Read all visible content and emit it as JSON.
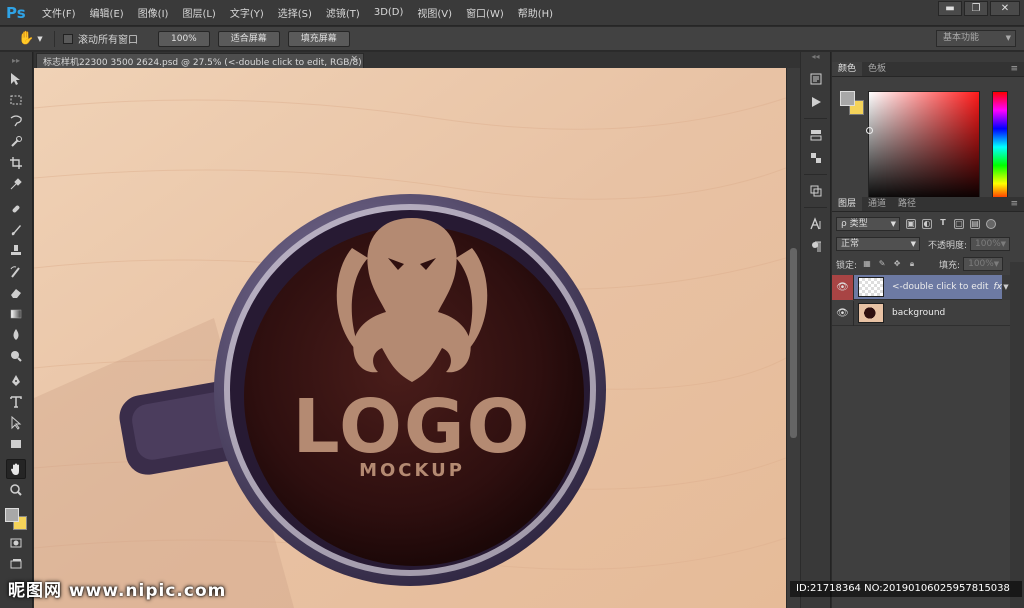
{
  "app": {
    "logo": "Ps",
    "menu": [
      "文件(F)",
      "编辑(E)",
      "图像(I)",
      "图层(L)",
      "文字(Y)",
      "选择(S)",
      "滤镜(T)",
      "3D(D)",
      "视图(V)",
      "窗口(W)",
      "帮助(H)"
    ],
    "window_controls": {
      "minimize": "▬",
      "restore": "❐",
      "close": "✕"
    }
  },
  "options_bar": {
    "scroll_all_label": "滚动所有窗口",
    "scroll_all_checked": false,
    "btn_100": "100%",
    "btn_fit": "适合屏幕",
    "btn_fill": "填充屏幕",
    "workspace": "基本功能"
  },
  "document": {
    "tab_title": "标志样机22300 3500 2624.psd @ 27.5% (<-double click to edit, RGB/8)",
    "tab_close": "×",
    "canvas_logo_text": "LOGO",
    "canvas_sub_text": "MOCKUP"
  },
  "color_panel": {
    "tabs": [
      "颜色",
      "色板"
    ],
    "active_tab": 0,
    "foreground": "#a8a8a8",
    "background": "#f4d35a"
  },
  "layers_panel": {
    "tabs": [
      "图层",
      "通道",
      "路径"
    ],
    "active_tab": 0,
    "filter_label": "ρ 类型",
    "blend_mode": "正常",
    "opacity_label": "不透明度:",
    "opacity_value": "100%",
    "lock_label": "锁定:",
    "fill_label": "填充:",
    "fill_value": "100%",
    "layers": [
      {
        "name": "<-double click to edit",
        "selected": true,
        "fx": "fx"
      },
      {
        "name": "background",
        "selected": false
      }
    ]
  },
  "watermark": {
    "site": "昵图网 www.nipic.com",
    "id_text": "ID:21718364 NO:20190106025957815038"
  },
  "colors": {
    "accent_ps": "#2fa3e6",
    "layer_selected": "#6d7aa3",
    "eye_selected": "#a84444"
  }
}
